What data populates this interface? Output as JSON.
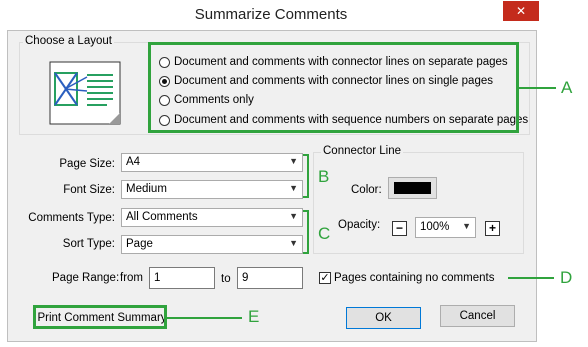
{
  "window": {
    "title": "Summarize Comments",
    "close_icon": "close-icon",
    "close_glyph": "✕"
  },
  "layout_group": {
    "title": "Choose a Layout",
    "preview_icon": "layout-preview-icon",
    "options": [
      {
        "label": "Document and comments with connector lines on separate pages",
        "checked": false
      },
      {
        "label": "Document and comments with connector lines on single pages",
        "checked": true
      },
      {
        "label": "Comments only",
        "checked": false
      },
      {
        "label": "Document and comments with sequence numbers on separate pages",
        "checked": false
      }
    ]
  },
  "fields": {
    "page_size": {
      "label": "Page Size:",
      "value": "A4"
    },
    "font_size": {
      "label": "Font Size:",
      "value": "Medium"
    },
    "comments_type": {
      "label": "Comments Type:",
      "value": "All Comments"
    },
    "sort_type": {
      "label": "Sort Type:",
      "value": "Page"
    },
    "chevron": "▼"
  },
  "connector": {
    "title": "Connector Line",
    "color_label": "Color:",
    "color": "#000000",
    "opacity_label": "Opacity:",
    "opacity_value": "100%",
    "minus": "−",
    "plus": "+"
  },
  "page_range": {
    "label": "Page Range:",
    "from_label": "from",
    "from_value": "1",
    "to_label": "to",
    "to_value": "9"
  },
  "no_comments": {
    "label": "Pages containing no comments",
    "checked": true,
    "mark": "✓"
  },
  "buttons": {
    "print_summary": "Print Comment Summary",
    "ok": "OK",
    "cancel": "Cancel"
  },
  "callouts": {
    "a": "A",
    "b": "B",
    "c": "C",
    "d": "D",
    "e": "E",
    "color": "#30a33d"
  }
}
